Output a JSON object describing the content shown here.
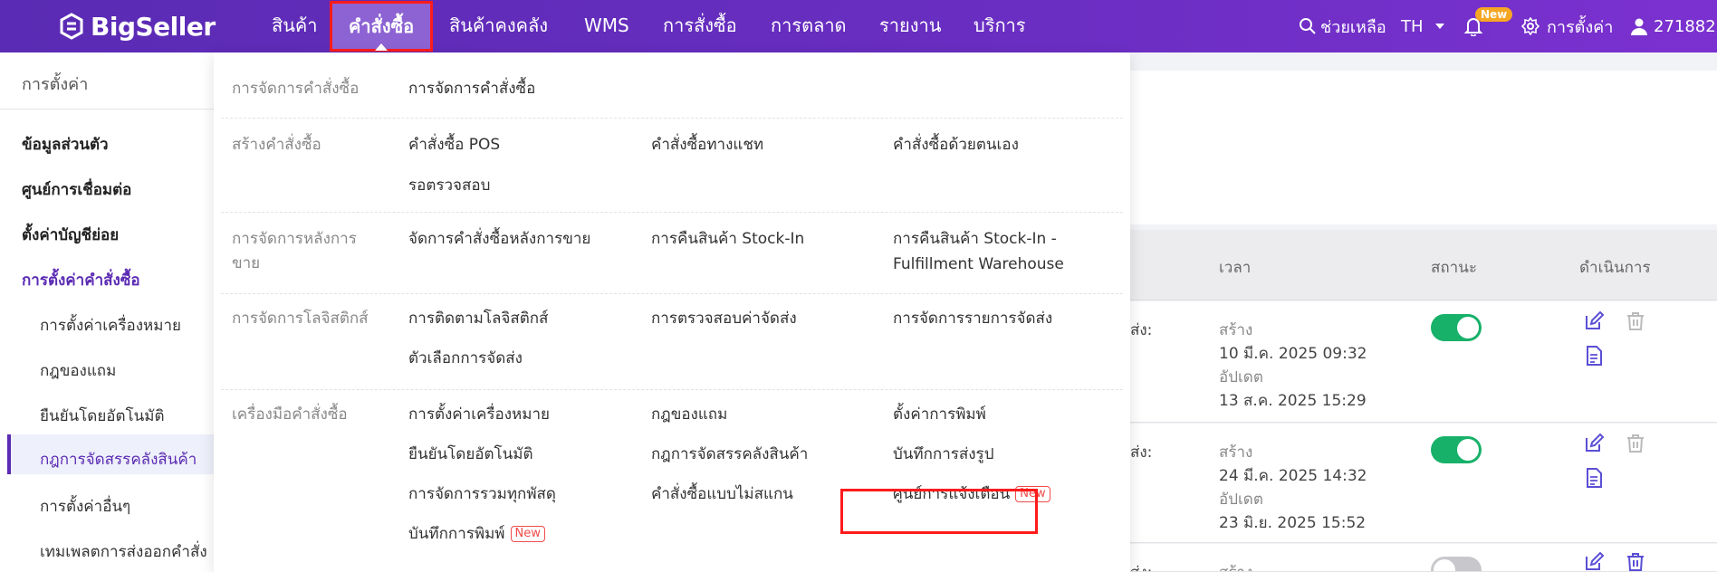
{
  "colors": {
    "brand_purple": "#5b2bb3",
    "toggle_on": "#17b169",
    "highlight_red": "#ff1b1b",
    "new_orange": "#f6a623"
  },
  "header": {
    "logo_text": "BigSeller",
    "nav": [
      "สินค้า",
      "คำสั่งซื้อ",
      "สินค้าคงคลัง",
      "WMS",
      "การสั่งซื้อ",
      "การตลาด",
      "รายงาน",
      "บริการ"
    ],
    "active_nav": "คำสั่งซื้อ",
    "help_label": "ช่วยเหลือ",
    "lang": "TH",
    "notif_badge": "New",
    "settings_label": "การตั้งค่า",
    "user_label": "271882..."
  },
  "sidebar": {
    "title": "การตั้งค่า",
    "items": [
      "ข้อมูลส่วนตัว",
      "ศูนย์การเชื่อมต่อ",
      "ตั้งค่าบัญชีย่อย",
      "การตั้งค่าคำสั่งซื้อ"
    ],
    "subitems": [
      "การตั้งค่าเครื่องหมาย",
      "กฎของแถม",
      "ยืนยันโดยอัตโนมัติ",
      "กฎการจัดสรรคลังสินค้า",
      "การตั้งค่าอื่นๆ",
      "เทมเพลตการส่งออกคำสั่ง"
    ]
  },
  "table": {
    "headers": [
      "เวลา",
      "สถานะ",
      "ดำเนินการ"
    ],
    "rows": [
      {
        "left_text": "ส่ง:",
        "created_label": "สร้าง",
        "created": "10 มี.ค. 2025 09:32",
        "updated_label": "อัปเดต",
        "updated": "13 ส.ค. 2025 15:29",
        "status_on": true
      },
      {
        "left_text": "ส่ง:",
        "created_label": "สร้าง",
        "created": "24 มี.ค. 2025 14:32",
        "updated_label": "อัปเดต",
        "updated": "23 มิ.ย. 2025 15:52",
        "status_on": true
      },
      {
        "left_text": "ส่ง:",
        "created_label": "สร้าง",
        "status_on": false
      }
    ]
  },
  "dropdown": {
    "manage": {
      "category": "การจัดการคำสั่งซื้อ",
      "links": [
        "การจัดการคำสั่งซื้อ"
      ]
    },
    "create": {
      "category": "สร้างคำสั่งซื้อ",
      "links": [
        "คำสั่งซื้อ POS",
        "คำสั่งซื้อทางแชท",
        "คำสั่งซื้อด้วยตนเอง",
        "รอตรวจสอบ"
      ]
    },
    "aftersale": {
      "category_1": "การจัดการหลังการ",
      "category_2": "ขาย",
      "link_1": "จัดการคำสั่งซื้อหลังการขาย",
      "link_2": "การคืนสินค้า Stock-In",
      "link_3a": "การคืนสินค้า Stock-In -",
      "link_3b": "Fulfillment Warehouse"
    },
    "logistics": {
      "category": "การจัดการโลจิสติกส์",
      "links": [
        "การติดตามโลจิสติกส์",
        "การตรวจสอบค่าจัดส่ง",
        "การจัดการรายการจัดส่ง",
        "ตัวเลือกการจัดส่ง"
      ]
    },
    "tools": {
      "category": "เครื่องมือคำสั่งซื้อ",
      "links": [
        "การตั้งค่าเครื่องหมาย",
        "กฎของแถม",
        "ตั้งค่าการพิมพ์",
        "ยืนยันโดยอัตโนมัติ",
        "กฎการจัดสรรคลังสินค้า",
        "บันทึกการส่งรูป",
        "การจัดการรวมทุกพัสดุ",
        "คำสั่งซื้อแบบไม่สแกน",
        "ศูนย์การแจ้งเตือน",
        "บันทึกการพิมพ์"
      ],
      "new_tag": "New"
    }
  }
}
